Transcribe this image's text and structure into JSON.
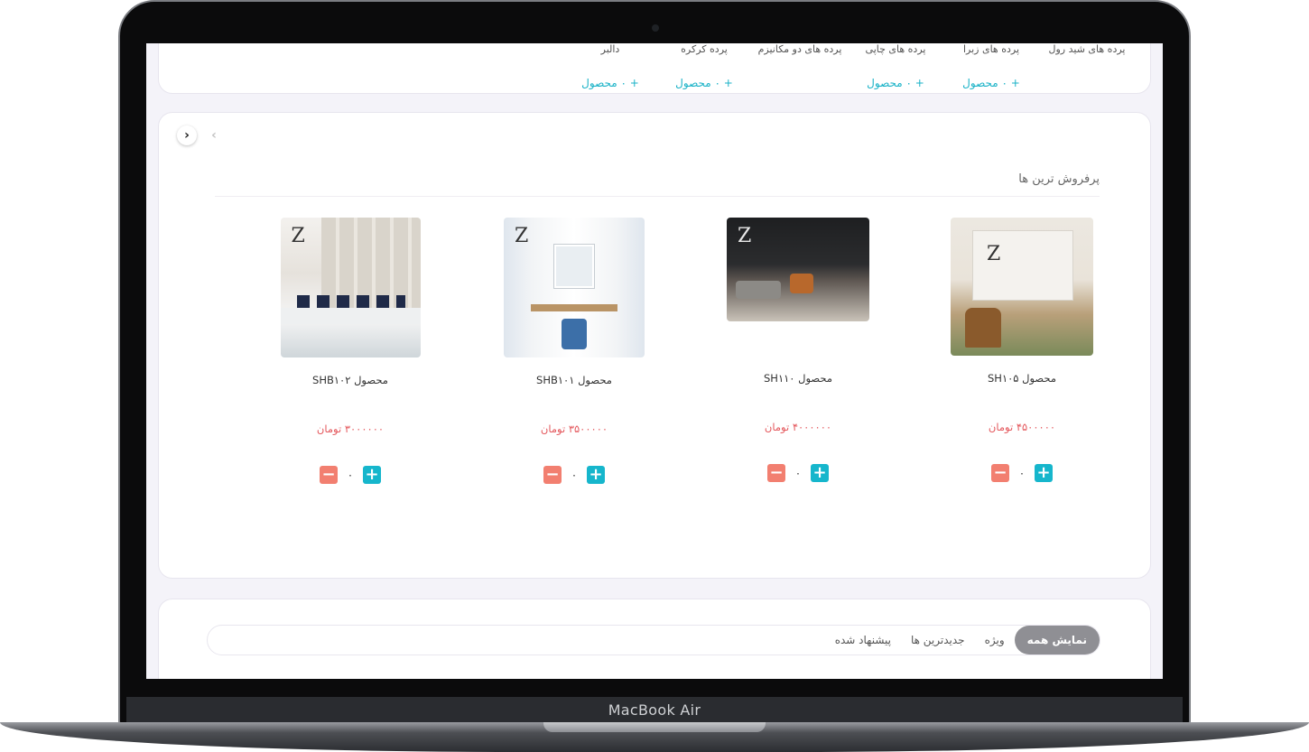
{
  "device": {
    "brand": "MacBook Air"
  },
  "categories": [
    {
      "name": "پرده های شید رول",
      "count": ""
    },
    {
      "name": "پرده های زبرا",
      "count": "+ ۰ محصول"
    },
    {
      "name": "پرده های چاپی",
      "count": "+ ۰ محصول"
    },
    {
      "name": "پرده های دو مکانیزم",
      "count": ""
    },
    {
      "name": "پرده کرکره",
      "count": "+ ۰ محصول"
    },
    {
      "name": "دالبر",
      "count": "+ ۰ محصول"
    }
  ],
  "bestsellers": {
    "title": "پرفروش ترین ها",
    "arrow_prev": "‹",
    "arrow_next": "›",
    "products": [
      {
        "name": "محصول SH۱۰۵",
        "price": "۴۵۰۰۰۰۰",
        "currency": "تومان",
        "qty": "۰",
        "minus": "−",
        "plus": "+"
      },
      {
        "name": "محصول SH۱۱۰",
        "price": "۴۰۰۰۰۰۰",
        "currency": "تومان",
        "qty": "۰",
        "minus": "−",
        "plus": "+"
      },
      {
        "name": "محصول SHB۱۰۱",
        "price": "۳۵۰۰۰۰۰",
        "currency": "تومان",
        "qty": "۰",
        "minus": "−",
        "plus": "+"
      },
      {
        "name": "محصول SHB۱۰۲",
        "price": "۳۰۰۰۰۰۰",
        "currency": "تومان",
        "qty": "۰",
        "minus": "−",
        "plus": "+"
      }
    ]
  },
  "tabs": [
    {
      "label": "نمایش همه",
      "active": true
    },
    {
      "label": "ویژه",
      "active": false
    },
    {
      "label": "جدیدترین ها",
      "active": false
    },
    {
      "label": "پیشنهاد شده",
      "active": false
    }
  ],
  "colors": {
    "accent": "#16b6cc",
    "price": "#e4585d",
    "minus": "#f27f70",
    "tab_active": "#8f8f94"
  }
}
